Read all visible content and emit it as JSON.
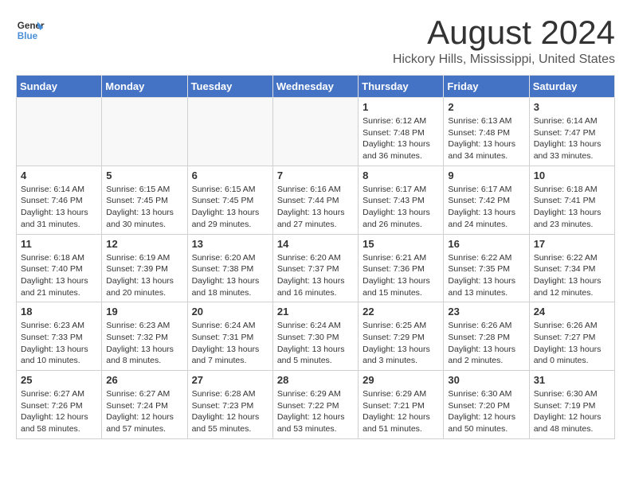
{
  "logo": {
    "line1": "General",
    "line2": "Blue"
  },
  "title": "August 2024",
  "location": "Hickory Hills, Mississippi, United States",
  "days_of_week": [
    "Sunday",
    "Monday",
    "Tuesday",
    "Wednesday",
    "Thursday",
    "Friday",
    "Saturday"
  ],
  "weeks": [
    [
      {
        "day": "",
        "info": ""
      },
      {
        "day": "",
        "info": ""
      },
      {
        "day": "",
        "info": ""
      },
      {
        "day": "",
        "info": ""
      },
      {
        "day": "1",
        "info": "Sunrise: 6:12 AM\nSunset: 7:48 PM\nDaylight: 13 hours and 36 minutes."
      },
      {
        "day": "2",
        "info": "Sunrise: 6:13 AM\nSunset: 7:48 PM\nDaylight: 13 hours and 34 minutes."
      },
      {
        "day": "3",
        "info": "Sunrise: 6:14 AM\nSunset: 7:47 PM\nDaylight: 13 hours and 33 minutes."
      }
    ],
    [
      {
        "day": "4",
        "info": "Sunrise: 6:14 AM\nSunset: 7:46 PM\nDaylight: 13 hours and 31 minutes."
      },
      {
        "day": "5",
        "info": "Sunrise: 6:15 AM\nSunset: 7:45 PM\nDaylight: 13 hours and 30 minutes."
      },
      {
        "day": "6",
        "info": "Sunrise: 6:15 AM\nSunset: 7:45 PM\nDaylight: 13 hours and 29 minutes."
      },
      {
        "day": "7",
        "info": "Sunrise: 6:16 AM\nSunset: 7:44 PM\nDaylight: 13 hours and 27 minutes."
      },
      {
        "day": "8",
        "info": "Sunrise: 6:17 AM\nSunset: 7:43 PM\nDaylight: 13 hours and 26 minutes."
      },
      {
        "day": "9",
        "info": "Sunrise: 6:17 AM\nSunset: 7:42 PM\nDaylight: 13 hours and 24 minutes."
      },
      {
        "day": "10",
        "info": "Sunrise: 6:18 AM\nSunset: 7:41 PM\nDaylight: 13 hours and 23 minutes."
      }
    ],
    [
      {
        "day": "11",
        "info": "Sunrise: 6:18 AM\nSunset: 7:40 PM\nDaylight: 13 hours and 21 minutes."
      },
      {
        "day": "12",
        "info": "Sunrise: 6:19 AM\nSunset: 7:39 PM\nDaylight: 13 hours and 20 minutes."
      },
      {
        "day": "13",
        "info": "Sunrise: 6:20 AM\nSunset: 7:38 PM\nDaylight: 13 hours and 18 minutes."
      },
      {
        "day": "14",
        "info": "Sunrise: 6:20 AM\nSunset: 7:37 PM\nDaylight: 13 hours and 16 minutes."
      },
      {
        "day": "15",
        "info": "Sunrise: 6:21 AM\nSunset: 7:36 PM\nDaylight: 13 hours and 15 minutes."
      },
      {
        "day": "16",
        "info": "Sunrise: 6:22 AM\nSunset: 7:35 PM\nDaylight: 13 hours and 13 minutes."
      },
      {
        "day": "17",
        "info": "Sunrise: 6:22 AM\nSunset: 7:34 PM\nDaylight: 13 hours and 12 minutes."
      }
    ],
    [
      {
        "day": "18",
        "info": "Sunrise: 6:23 AM\nSunset: 7:33 PM\nDaylight: 13 hours and 10 minutes."
      },
      {
        "day": "19",
        "info": "Sunrise: 6:23 AM\nSunset: 7:32 PM\nDaylight: 13 hours and 8 minutes."
      },
      {
        "day": "20",
        "info": "Sunrise: 6:24 AM\nSunset: 7:31 PM\nDaylight: 13 hours and 7 minutes."
      },
      {
        "day": "21",
        "info": "Sunrise: 6:24 AM\nSunset: 7:30 PM\nDaylight: 13 hours and 5 minutes."
      },
      {
        "day": "22",
        "info": "Sunrise: 6:25 AM\nSunset: 7:29 PM\nDaylight: 13 hours and 3 minutes."
      },
      {
        "day": "23",
        "info": "Sunrise: 6:26 AM\nSunset: 7:28 PM\nDaylight: 13 hours and 2 minutes."
      },
      {
        "day": "24",
        "info": "Sunrise: 6:26 AM\nSunset: 7:27 PM\nDaylight: 13 hours and 0 minutes."
      }
    ],
    [
      {
        "day": "25",
        "info": "Sunrise: 6:27 AM\nSunset: 7:26 PM\nDaylight: 12 hours and 58 minutes."
      },
      {
        "day": "26",
        "info": "Sunrise: 6:27 AM\nSunset: 7:24 PM\nDaylight: 12 hours and 57 minutes."
      },
      {
        "day": "27",
        "info": "Sunrise: 6:28 AM\nSunset: 7:23 PM\nDaylight: 12 hours and 55 minutes."
      },
      {
        "day": "28",
        "info": "Sunrise: 6:29 AM\nSunset: 7:22 PM\nDaylight: 12 hours and 53 minutes."
      },
      {
        "day": "29",
        "info": "Sunrise: 6:29 AM\nSunset: 7:21 PM\nDaylight: 12 hours and 51 minutes."
      },
      {
        "day": "30",
        "info": "Sunrise: 6:30 AM\nSunset: 7:20 PM\nDaylight: 12 hours and 50 minutes."
      },
      {
        "day": "31",
        "info": "Sunrise: 6:30 AM\nSunset: 7:19 PM\nDaylight: 12 hours and 48 minutes."
      }
    ]
  ]
}
